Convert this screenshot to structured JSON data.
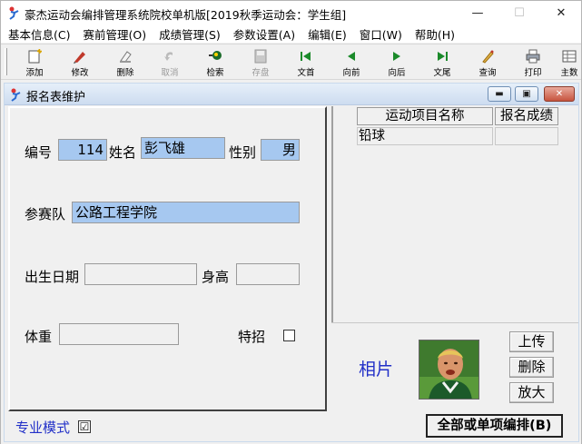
{
  "window": {
    "title": "豪杰运动会编排管理系统院校单机版[2019秋季运动会：学生组]",
    "minimize": "—",
    "maximize": "☐",
    "close": "✕"
  },
  "menu": [
    "基本信息(C)",
    "赛前管理(O)",
    "成绩管理(S)",
    "参数设置(A)",
    "编辑(E)",
    "窗口(W)",
    "帮助(H)"
  ],
  "toolbar": [
    {
      "label": "添加",
      "icon": "add-icon",
      "enabled": true
    },
    {
      "label": "修改",
      "icon": "edit-icon",
      "enabled": true
    },
    {
      "label": "删除",
      "icon": "delete-icon",
      "enabled": true
    },
    {
      "label": "取消",
      "icon": "cancel-icon",
      "enabled": false
    },
    {
      "label": "检索",
      "icon": "search-icon",
      "enabled": true
    },
    {
      "label": "存盘",
      "icon": "save-icon",
      "enabled": false
    },
    {
      "label": "文首",
      "icon": "first-icon",
      "enabled": true
    },
    {
      "label": "向前",
      "icon": "prev-icon",
      "enabled": true
    },
    {
      "label": "向后",
      "icon": "next-icon",
      "enabled": true
    },
    {
      "label": "文尾",
      "icon": "last-icon",
      "enabled": true
    },
    {
      "label": "查询",
      "icon": "query-icon",
      "enabled": true
    },
    {
      "label": "打印",
      "icon": "print-icon",
      "enabled": true
    },
    {
      "label": "主数",
      "icon": "main-icon",
      "enabled": true
    }
  ],
  "child": {
    "title": "报名表维护",
    "min": "▬",
    "max": "▣",
    "close": "✕"
  },
  "form": {
    "number_label": "编号",
    "number_value": "114",
    "name_label": "姓名",
    "name_value": "彭飞雄",
    "gender_label": "性别",
    "gender_value": "男",
    "team_label": "参赛队",
    "team_value": "公路工程学院",
    "birth_label": "出生日期",
    "birth_value": "",
    "height_label": "身高",
    "height_value": "",
    "weight_label": "体重",
    "weight_value": "",
    "special_label": "特招"
  },
  "grid": {
    "headers": [
      "运动项目名称",
      "报名成绩"
    ],
    "rows": [
      [
        "铅球",
        ""
      ]
    ]
  },
  "photo": {
    "label": "相片",
    "upload": "上传",
    "delete": "删除",
    "zoom": "放大"
  },
  "bottom": {
    "mode_label": "专业模式",
    "mode_checked": "☑",
    "arrange_button": "全部或单项编排(B)"
  }
}
